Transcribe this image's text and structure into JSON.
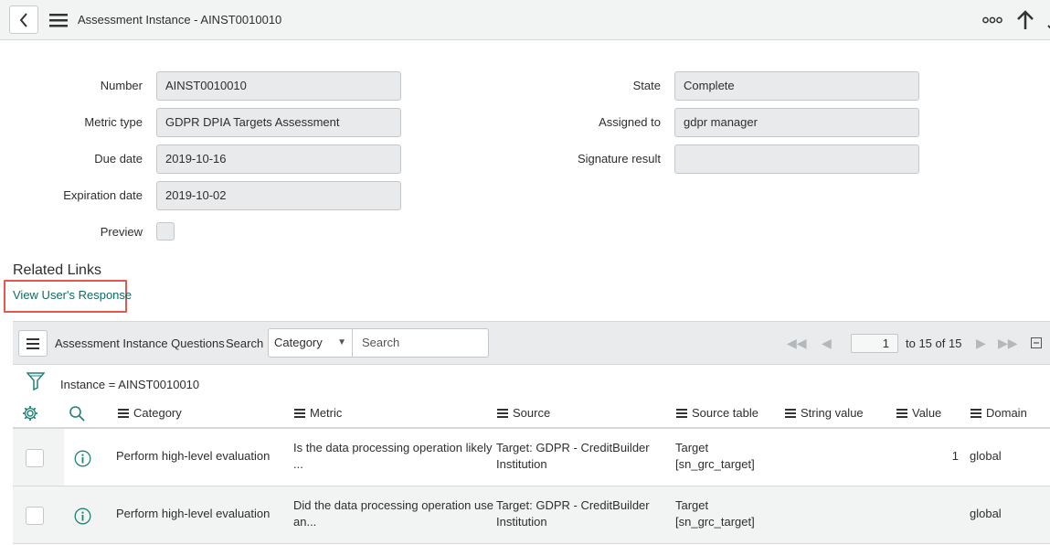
{
  "header": {
    "title": "Assessment Instance - AINST0010010"
  },
  "form": {
    "number_label": "Number",
    "number_value": "AINST0010010",
    "metric_type_label": "Metric type",
    "metric_type_value": "GDPR DPIA Targets Assessment",
    "due_date_label": "Due date",
    "due_date_value": "2019-10-16",
    "expiration_date_label": "Expiration date",
    "expiration_date_value": "2019-10-02",
    "preview_label": "Preview",
    "state_label": "State",
    "state_value": "Complete",
    "assigned_to_label": "Assigned to",
    "assigned_to_value": "gdpr manager",
    "signature_result_label": "Signature result",
    "signature_result_value": ""
  },
  "related_links": {
    "title": "Related Links",
    "view_response": "View User's Response"
  },
  "list": {
    "title": "Assessment Instance Questions",
    "search_label": "Search",
    "search_field": "Category",
    "search_placeholder": "Search",
    "page_value": "1",
    "page_count": "to 15 of 15",
    "breadcrumb": "Instance = AINST0010010",
    "columns": [
      "Category",
      "Metric",
      "Source",
      "Source table",
      "String value",
      "Value",
      "Domain"
    ],
    "rows": [
      {
        "category": "Perform high-level evaluation",
        "metric_line1": "Is the data processing operation likely",
        "metric_line2": "...",
        "source_line1": "Target: GDPR - CreditBuilder",
        "source_line2": "Institution",
        "source_table_line1": "Target",
        "source_table_line2": "[sn_grc_target]",
        "string_value": "",
        "value": "1",
        "domain": "global"
      },
      {
        "category": "Perform high-level evaluation",
        "metric_line1": "Did the data processing operation use",
        "metric_line2": "an...",
        "source_line1": "Target: GDPR - CreditBuilder",
        "source_line2": "Institution",
        "source_table_line1": "Target",
        "source_table_line2": "[sn_grc_target]",
        "string_value": "",
        "value": "",
        "domain": "global"
      }
    ]
  },
  "colors": {
    "accent_link": "#0f6b66",
    "highlight_box": "#e8574f",
    "header_bg": "#f2f3f3"
  },
  "icons": [
    "chevron-left-icon",
    "hamburger-menu-icon",
    "more-options-icon",
    "arrow-up-icon",
    "filter-icon",
    "gear-icon",
    "search-icon",
    "info-circle-icon",
    "first-page-icon",
    "prev-page-icon",
    "next-page-icon",
    "last-page-icon",
    "collapse-icon",
    "caret-down-icon"
  ]
}
